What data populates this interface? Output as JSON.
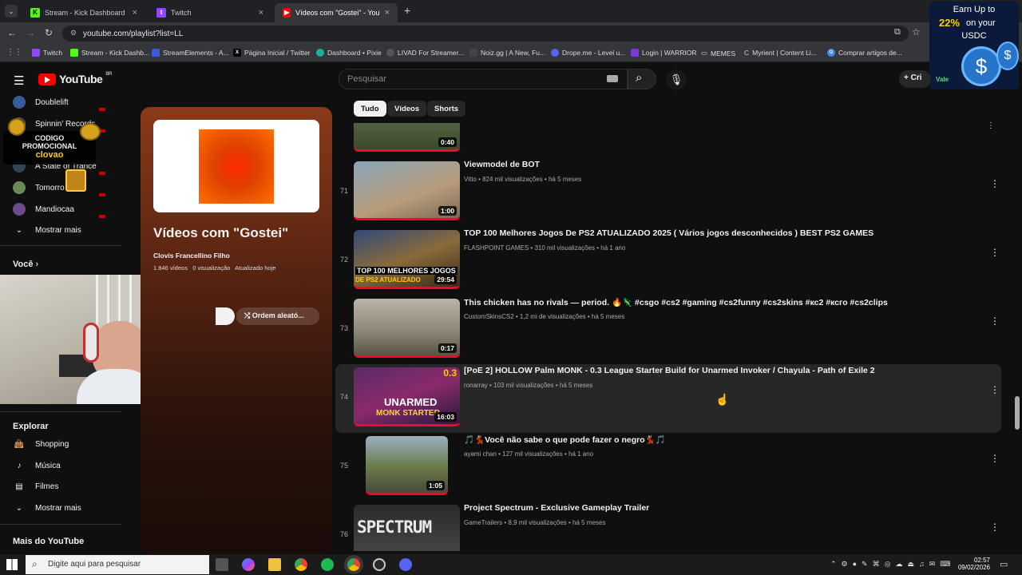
{
  "browser": {
    "tabs": [
      {
        "label": "Stream - Kick Dashboard",
        "color": "#53fc18"
      },
      {
        "label": "Twitch",
        "color": "#9146ff"
      },
      {
        "label": "Vídeos com \"Gostei\" - YouTube",
        "color": "#ff0000"
      }
    ],
    "new_tab": "+",
    "url": "youtube.com/playlist?list=LL",
    "bookmarks": [
      "Twitch",
      "Stream - Kick Dashb...",
      "StreamElements - A...",
      "Página Inicial / Twitter",
      "Dashboard • Pixie",
      "LIVAD For Streamer...",
      "Noiz.gg | A New, Fu...",
      "Drope.me - Level u...",
      "Login | WARRIOR",
      "MEMES",
      "Myrient | Content Li...",
      "Comprar artigos de..."
    ]
  },
  "ad": {
    "line1": "Earn Up to",
    "line2": "22%",
    "line3": "on your",
    "line4": "USDC",
    "cta": "Vale"
  },
  "youtube": {
    "logo": "YouTube",
    "region": "BR",
    "search_placeholder": "Pesquisar",
    "create_label": "Cri",
    "subscriptions": [
      "Doublelift",
      "Spinnin' Records",
      "A State of Trance",
      "Tomorro",
      "Mandiocaa"
    ],
    "show_more": "Mostrar mais",
    "you_section": "Você",
    "explore_title": "Explorar",
    "explore_items": [
      "Shopping",
      "Música",
      "Filmes"
    ],
    "show_more2": "Mostrar mais",
    "more_title": "Mais do YouTube",
    "promo": {
      "line1": "CODIGO",
      "line2": "PROMOCIONAL",
      "code": "clovao"
    },
    "playlist": {
      "title": "Vídeos com \"Gostei\"",
      "owner": "Clovis Francellino Filho",
      "stats": "1.846 vídeos   0 visualização   Atualizado hoje",
      "shuffle": "Ordem aleató..."
    },
    "chips": [
      "Tudo",
      "Vídeos",
      "Shorts"
    ],
    "videos": [
      {
        "idx": "71",
        "title": "Viewmodel de BOT",
        "meta": "Vitto • 824 mil visualizações • há 5 meses",
        "duration": "1:00"
      },
      {
        "idx": "72",
        "title": "TOP 100 Melhores Jogos De PS2 ATUALIZADO 2025 ( Vários jogos desconhecidos ) BEST PS2 GAMES",
        "meta": "FLASHPOINT GAMES • 310 mil visualizações • há 1 ano",
        "duration": "29:54"
      },
      {
        "idx": "73",
        "title": "This chicken has no rivals — period. 🔥🦎 #csgo #cs2 #gaming #cs2funny #cs2skins #кс2 #ксго #cs2clips",
        "meta": "CustomSkinsCS2 • 1,2 mi de visualizações • há 5 meses",
        "duration": "0:17"
      },
      {
        "idx": "74",
        "title": "[PoE 2] HOLLOW Palm MONK - 0.3 League Starter Build for Unarmed Invoker / Chayula - Path of Exile 2",
        "meta": "ronarray • 103 mil visualizações • há 5 meses",
        "duration": "16:03"
      },
      {
        "idx": "75",
        "title": "🎵💃Você não sabe o que pode fazer o negro💃🎵",
        "meta": "ayami chan • 127 mil visualizações • há 1 ano",
        "duration": "1:05"
      },
      {
        "idx": "76",
        "title": "Project Spectrum - Exclusive Gameplay Trailer",
        "meta": "GameTrailers • 8,9 mil visualizações • há 5 meses",
        "duration": ""
      }
    ],
    "partial_duration": "0:40",
    "thumb_texts": {
      "ps2a": "TOP 100 MELHORES JOGOS",
      "ps2b": "DE PS2 ATUALIZADO",
      "poe_num": "0.3",
      "poe_a": "UNARMED",
      "poe_b": "MONK STARTER",
      "spectrum": "SPECTRUM"
    }
  },
  "taskbar": {
    "search_placeholder": "Digite aqui para pesquisar",
    "time": "02:57",
    "date": "09/02/2026"
  }
}
